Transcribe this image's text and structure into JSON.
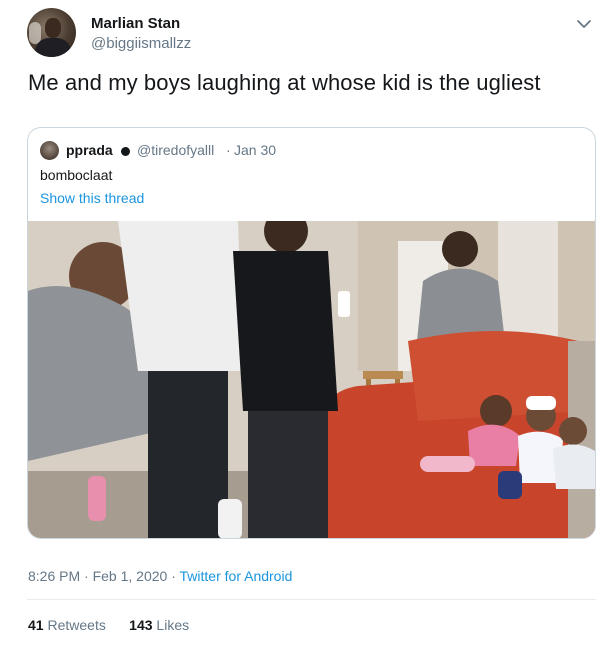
{
  "tweet": {
    "author_name": "Marlian Stan",
    "author_handle": "@biggiismallzz",
    "text": "Me and my boys laughing at whose kid is the ugliest",
    "time": "8:26 PM",
    "date_sep": "·",
    "date": "Feb 1, 2020",
    "source_sep": "·",
    "source": "Twitter for Android",
    "retweets_count": "41",
    "retweets_label": "Retweets",
    "likes_count": "143",
    "likes_label": "Likes"
  },
  "quoted": {
    "author_name": "pprada",
    "author_handle": "@tiredofyalll",
    "sep": "·",
    "date": "Jan 30",
    "text": "bomboclaat",
    "show_thread": "Show this thread"
  },
  "icons": {
    "menu": "chevron-down-icon",
    "avatar": "avatar-image",
    "quoted_avatar": "avatar-image",
    "verified_like_badge": "black-circle-emoji"
  },
  "colors": {
    "text": "#14171a",
    "secondary": "#657786",
    "link": "#1b95e0",
    "border": "#ccd6dd",
    "couch": "#c8452c"
  }
}
